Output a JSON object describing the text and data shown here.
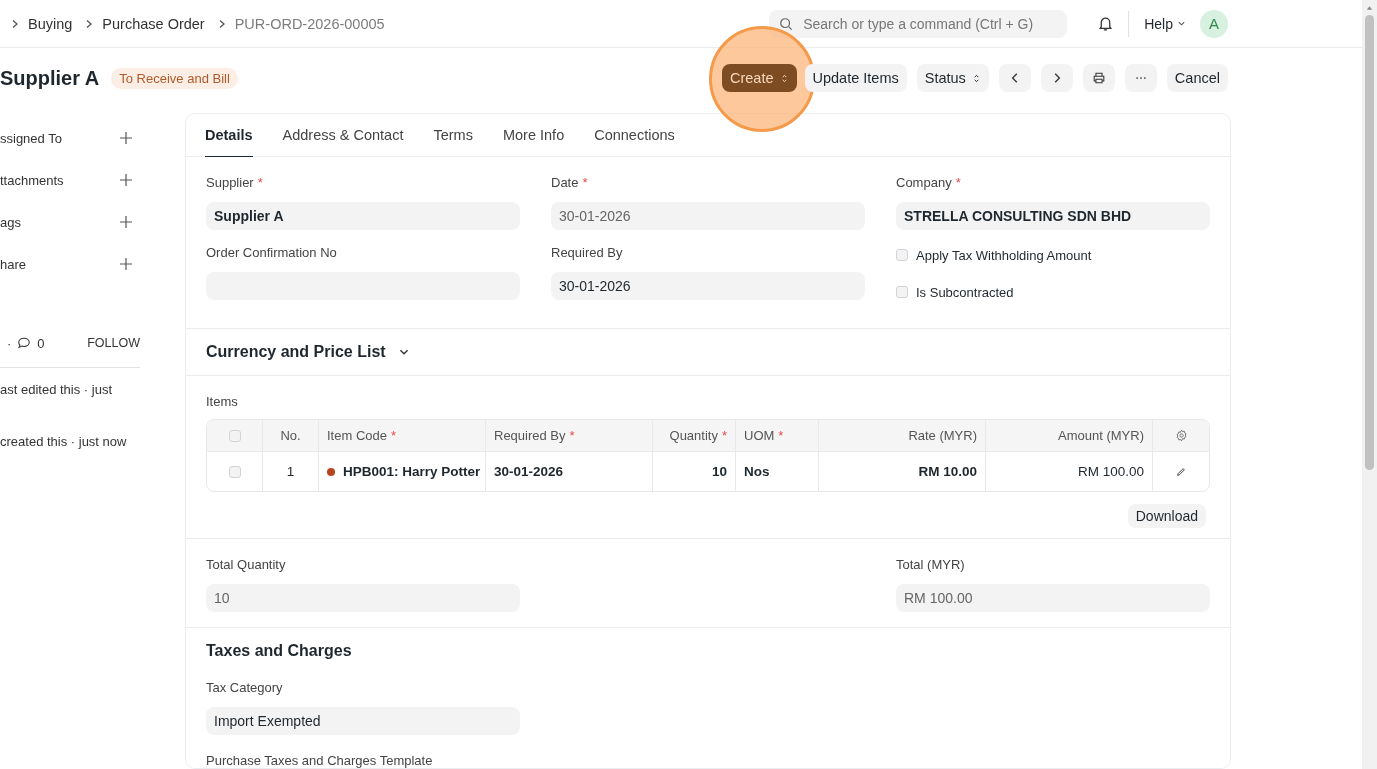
{
  "breadcrumbs": [
    {
      "label": "Buying",
      "current": false
    },
    {
      "label": "Purchase Order",
      "current": false
    },
    {
      "label": "PUR-ORD-2026-00005",
      "current": true
    }
  ],
  "search": {
    "placeholder": "Search or type a command (Ctrl + G)"
  },
  "help": {
    "label": "Help"
  },
  "avatar": {
    "initial": "A"
  },
  "title": "Supplier A",
  "status_badge": "To Receive and Bill",
  "actions": [
    {
      "kind": "menu",
      "label": "Create",
      "primary": true,
      "highlighted": true
    },
    {
      "kind": "text",
      "label": "Update Items",
      "primary": false,
      "highlighted": false
    },
    {
      "kind": "menu",
      "label": "Status",
      "primary": false,
      "highlighted": false
    },
    {
      "kind": "prev",
      "primary": false,
      "highlighted": false
    },
    {
      "kind": "next",
      "primary": false,
      "highlighted": false
    },
    {
      "kind": "print",
      "primary": false,
      "highlighted": false
    },
    {
      "kind": "more",
      "primary": false,
      "highlighted": false
    },
    {
      "kind": "text",
      "label": "Cancel",
      "primary": false,
      "highlighted": false
    }
  ],
  "sidebar": {
    "items": [
      {
        "label": "ssigned To"
      },
      {
        "label": "ttachments"
      },
      {
        "label": "ags"
      },
      {
        "label": "hare"
      }
    ],
    "separator": "·",
    "comments": "0",
    "follow": "FOLLOW",
    "activity": [
      {
        "text": "ast edited this · just"
      },
      {
        "text": "created this · just now"
      }
    ]
  },
  "tabs": [
    {
      "label": "Details",
      "selected": true
    },
    {
      "label": "Address & Contact",
      "selected": false
    },
    {
      "label": "Terms",
      "selected": false
    },
    {
      "label": "More Info",
      "selected": false
    },
    {
      "label": "Connections",
      "selected": false
    }
  ],
  "details": {
    "columns": [
      [
        {
          "kind": "field",
          "label": "Supplier",
          "required_mark": "*",
          "value": "Supplier A",
          "bold": true,
          "readonly": false
        },
        {
          "kind": "field",
          "label": "Order Confirmation No"
        }
      ],
      [
        {
          "kind": "field",
          "label": "Date",
          "required_mark": "*",
          "value": "30-01-2026",
          "bold": false,
          "readonly": true
        },
        {
          "kind": "field",
          "label": "Required By",
          "value": "30-01-2026",
          "bold": false,
          "readonly": false
        }
      ],
      [
        {
          "kind": "field",
          "label": "Company",
          "required_mark": "*",
          "value": "STRELLA CONSULTING SDN BHD",
          "bold": true,
          "readonly": false
        },
        {
          "kind": "checkbox",
          "label": "Apply Tax Withholding Amount",
          "checked": false
        },
        {
          "kind": "checkbox",
          "label": "Is Subcontracted",
          "checked": false
        }
      ]
    ]
  },
  "currency_section": {
    "title": "Currency and Price List",
    "expanded": false
  },
  "items": {
    "label": "Items",
    "all_checked": false,
    "columns": [
      {
        "label": "No."
      },
      {
        "label": "Item Code",
        "required_mark": "*"
      },
      {
        "label": "Required By",
        "required_mark": "*"
      },
      {
        "label": "Quantity",
        "required_mark": "*"
      },
      {
        "label": "UOM",
        "required_mark": "*"
      },
      {
        "label": "Rate (MYR)"
      },
      {
        "label": "Amount (MYR)"
      }
    ],
    "rows": [
      {
        "checked": false,
        "cells": [
          "1",
          "HPB001: Harry Potter",
          "30-01-2026",
          "10",
          "Nos",
          "RM 10.00",
          "RM 100.00"
        ],
        "color": "#b5461f"
      }
    ],
    "download": "Download"
  },
  "totals": [
    {
      "label": "Total Quantity",
      "value": "10"
    },
    {
      "label": "Total (MYR)",
      "value": "RM 100.00"
    }
  ],
  "taxes": {
    "title": "Taxes and Charges",
    "tax_category": {
      "label": "Tax Category",
      "value": "Import Exempted"
    },
    "template_label": "Purchase Taxes and Charges Template"
  }
}
